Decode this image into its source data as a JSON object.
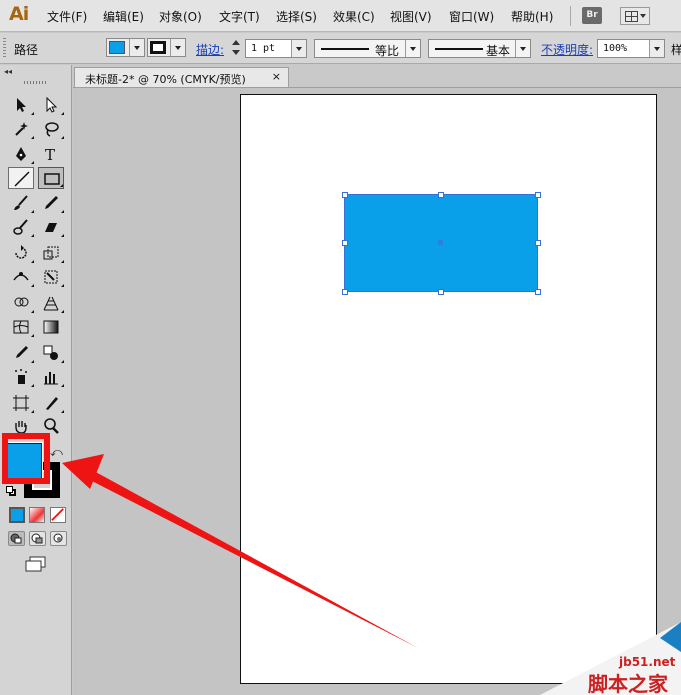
{
  "app": {
    "logo": "Ai",
    "bridge_label": "Br"
  },
  "menu": [
    "文件(F)",
    "编辑(E)",
    "对象(O)",
    "文字(T)",
    "选择(S)",
    "效果(C)",
    "视图(V)",
    "窗口(W)",
    "帮助(H)"
  ],
  "control": {
    "object_type": "路径",
    "stroke_label": "描边:",
    "stroke_weight": "1 pt",
    "profile_label": "等比",
    "brush_label": "基本",
    "opacity_label": "不透明度:",
    "opacity_value": "100%",
    "cut_text": "样"
  },
  "document": {
    "tab_title": "未标题-2* @ 70% (CMYK/预览)",
    "close_glyph": "×"
  },
  "tools": [
    "selection-tool",
    "direct-selection-tool",
    "magic-wand-tool",
    "lasso-tool",
    "pen-tool",
    "type-tool",
    "line-segment-tool",
    "rectangle-tool",
    "paintbrush-tool",
    "pencil-tool",
    "blob-brush-tool",
    "eraser-tool",
    "rotate-tool",
    "scale-tool",
    "width-tool",
    "free-transform-tool",
    "shape-builder-tool",
    "perspective-grid-tool",
    "mesh-tool",
    "gradient-tool",
    "eyedropper-tool",
    "blend-tool",
    "symbol-sprayer-tool",
    "column-graph-tool",
    "artboard-tool",
    "slice-tool",
    "hand-tool",
    "zoom-tool"
  ],
  "colors": {
    "fill": "#0aa0e9",
    "accent": "#ef1414",
    "selection": "#3a6fd8"
  },
  "watermark": {
    "site": "jb51.net",
    "name": "脚本之家"
  }
}
